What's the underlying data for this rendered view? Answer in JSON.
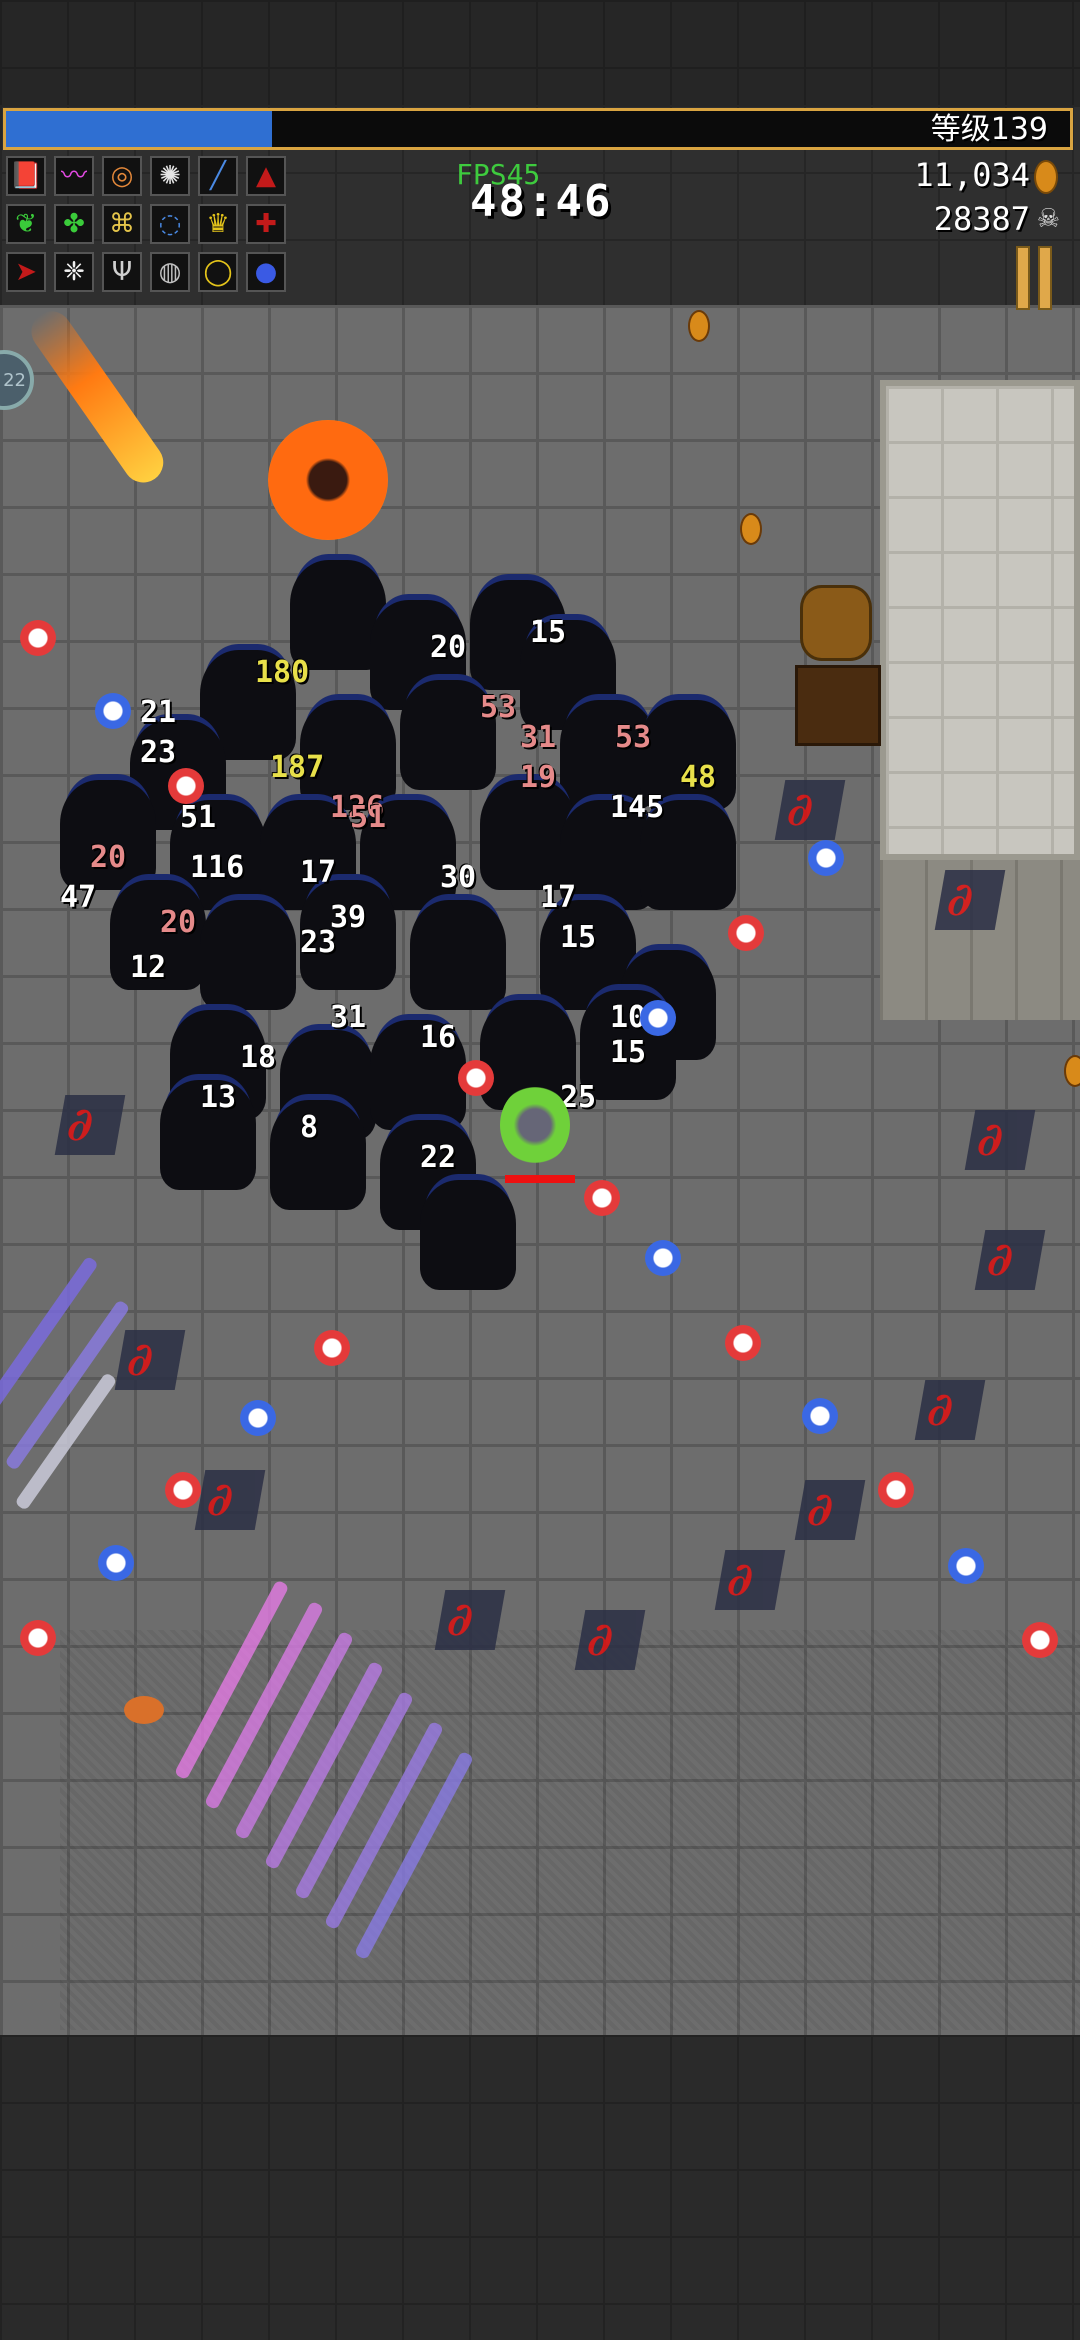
{
  "hud": {
    "level_label": "等级139",
    "level_value": 139,
    "xp_progress": 0.25,
    "fps": "FPS45",
    "timer": "48:46",
    "gold": "11,034",
    "kills": "28387",
    "side_counter": "22"
  },
  "inventory_icons": [
    {
      "name": "book-icon",
      "glyph": "📕",
      "color": "#c31a1a"
    },
    {
      "name": "whip-icon",
      "glyph": "〰",
      "color": "#e44ae4"
    },
    {
      "name": "garlic-ring-icon",
      "glyph": "◎",
      "color": "#e4883a"
    },
    {
      "name": "skull-aura-icon",
      "glyph": "✺",
      "color": "#e4e4e4"
    },
    {
      "name": "wand-icon",
      "glyph": "╱",
      "color": "#4a8ae4"
    },
    {
      "name": "axe-icon",
      "glyph": "▲",
      "color": "#c31a1a"
    },
    {
      "name": "leaf-icon",
      "glyph": "❦",
      "color": "#3acb3a"
    },
    {
      "name": "clover-icon",
      "glyph": "✤",
      "color": "#3acb3a"
    },
    {
      "name": "rune-icon",
      "glyph": "⌘",
      "color": "#e4c44a"
    },
    {
      "name": "orb-ring-icon",
      "glyph": "◌",
      "color": "#4a8ae4"
    },
    {
      "name": "crown-icon",
      "glyph": "♛",
      "color": "#e4c41a"
    },
    {
      "name": "cross-icon",
      "glyph": "✚",
      "color": "#c31a1a"
    },
    {
      "name": "arrow-icon",
      "glyph": "➤",
      "color": "#c31a1a"
    },
    {
      "name": "wings-icon",
      "glyph": "❈",
      "color": "#f0f0f0"
    },
    {
      "name": "candelabra-icon",
      "glyph": "Ψ",
      "color": "#d0d0d0"
    },
    {
      "name": "armor-icon",
      "glyph": "◍",
      "color": "#c0c0c0"
    },
    {
      "name": "gold-ring-icon",
      "glyph": "◯",
      "color": "#e4c41a"
    },
    {
      "name": "blue-orb-icon",
      "glyph": "●",
      "color": "#3a5ae4"
    }
  ],
  "damage_numbers": [
    "180",
    "21",
    "20",
    "15",
    "23",
    "31",
    "53",
    "19",
    "48",
    "126",
    "51",
    "145",
    "116",
    "17",
    "20",
    "30",
    "12",
    "23",
    "15",
    "10",
    "31",
    "16",
    "18",
    "13",
    "25",
    "8",
    "22",
    "20",
    "47",
    "187",
    "53",
    "51",
    "39",
    "17",
    "15"
  ],
  "colors": {
    "xp_fill": "#2f6fd2",
    "xp_border": "#d9a441",
    "fps": "#3ecb3e",
    "hp_bar": "#e11111"
  }
}
